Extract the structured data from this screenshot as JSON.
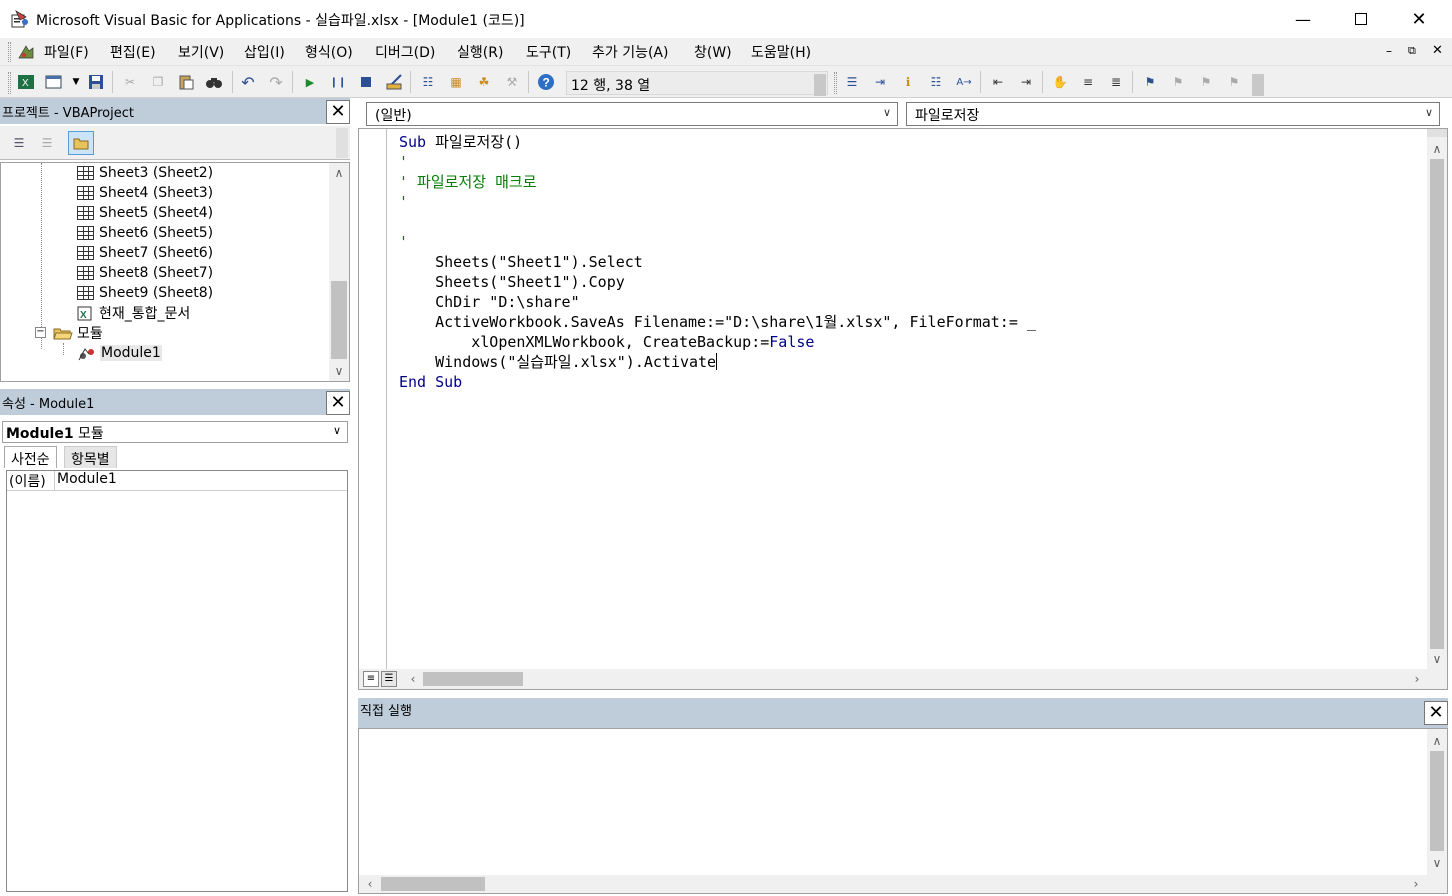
{
  "window": {
    "title": "Microsoft Visual Basic for Applications - 실습파일.xlsx - [Module1 (코드)]",
    "minimize_icon": "minimize-icon",
    "maximize_icon": "maximize-icon",
    "close_icon": "close-icon"
  },
  "menu": {
    "items": [
      "파일(F)",
      "편집(E)",
      "보기(V)",
      "삽입(I)",
      "형식(O)",
      "디버그(D)",
      "실행(R)",
      "도구(T)",
      "추가 기능(A)",
      "창(W)",
      "도움말(H)"
    ]
  },
  "toolbar": {
    "position": "12 행, 38 열"
  },
  "project_panel": {
    "title": "프로젝트 - VBAProject",
    "tree": [
      {
        "label": "Sheet3 (Sheet2)",
        "icon": "sheet-icon"
      },
      {
        "label": "Sheet4 (Sheet3)",
        "icon": "sheet-icon"
      },
      {
        "label": "Sheet5 (Sheet4)",
        "icon": "sheet-icon"
      },
      {
        "label": "Sheet6 (Sheet5)",
        "icon": "sheet-icon"
      },
      {
        "label": "Sheet7 (Sheet6)",
        "icon": "sheet-icon"
      },
      {
        "label": "Sheet8 (Sheet7)",
        "icon": "sheet-icon"
      },
      {
        "label": "Sheet9 (Sheet8)",
        "icon": "sheet-icon"
      },
      {
        "label": "현재_통합_문서",
        "icon": "workbook-icon"
      },
      {
        "label": "모듈",
        "icon": "folder-icon"
      },
      {
        "label": "Module1",
        "icon": "module-icon"
      }
    ]
  },
  "properties_panel": {
    "title": "속성 - Module1",
    "object": "Module1",
    "object_type": "모듈",
    "tabs": [
      "사전순",
      "항목별"
    ],
    "rows": [
      {
        "name": "(이름)",
        "value": "Module1"
      }
    ]
  },
  "code_window": {
    "object_combo": "(일반)",
    "procedure_combo": "파일로저장",
    "lines": [
      {
        "kw": "Sub",
        "rest": " 파일로저장()",
        "type": "code"
      },
      {
        "text": "'",
        "type": "comment"
      },
      {
        "text": "' 파일로저장 매크로",
        "type": "comment"
      },
      {
        "text": "'",
        "type": "comment"
      },
      {
        "text": "",
        "type": "blank"
      },
      {
        "text": "'",
        "type": "comment"
      },
      {
        "text": "    Sheets(\"Sheet1\").Select",
        "type": "plain"
      },
      {
        "text": "    Sheets(\"Sheet1\").Copy",
        "type": "plain"
      },
      {
        "text": "    ChDir \"D:\\share\"",
        "type": "plain"
      },
      {
        "text": "    ActiveWorkbook.SaveAs Filename:=\"D:\\share\\1월.xlsx\", FileFormat:= _",
        "type": "plain"
      },
      {
        "pre": "        xlOpenXMLWorkbook, CreateBackup:=",
        "kw": "False",
        "type": "trailing-kw"
      },
      {
        "text": "    Windows(\"실습파일.xlsx\").Activate",
        "type": "cursor"
      },
      {
        "kw": "End Sub",
        "type": "kwonly"
      }
    ]
  },
  "immediate_panel": {
    "title": "직접 실행"
  }
}
